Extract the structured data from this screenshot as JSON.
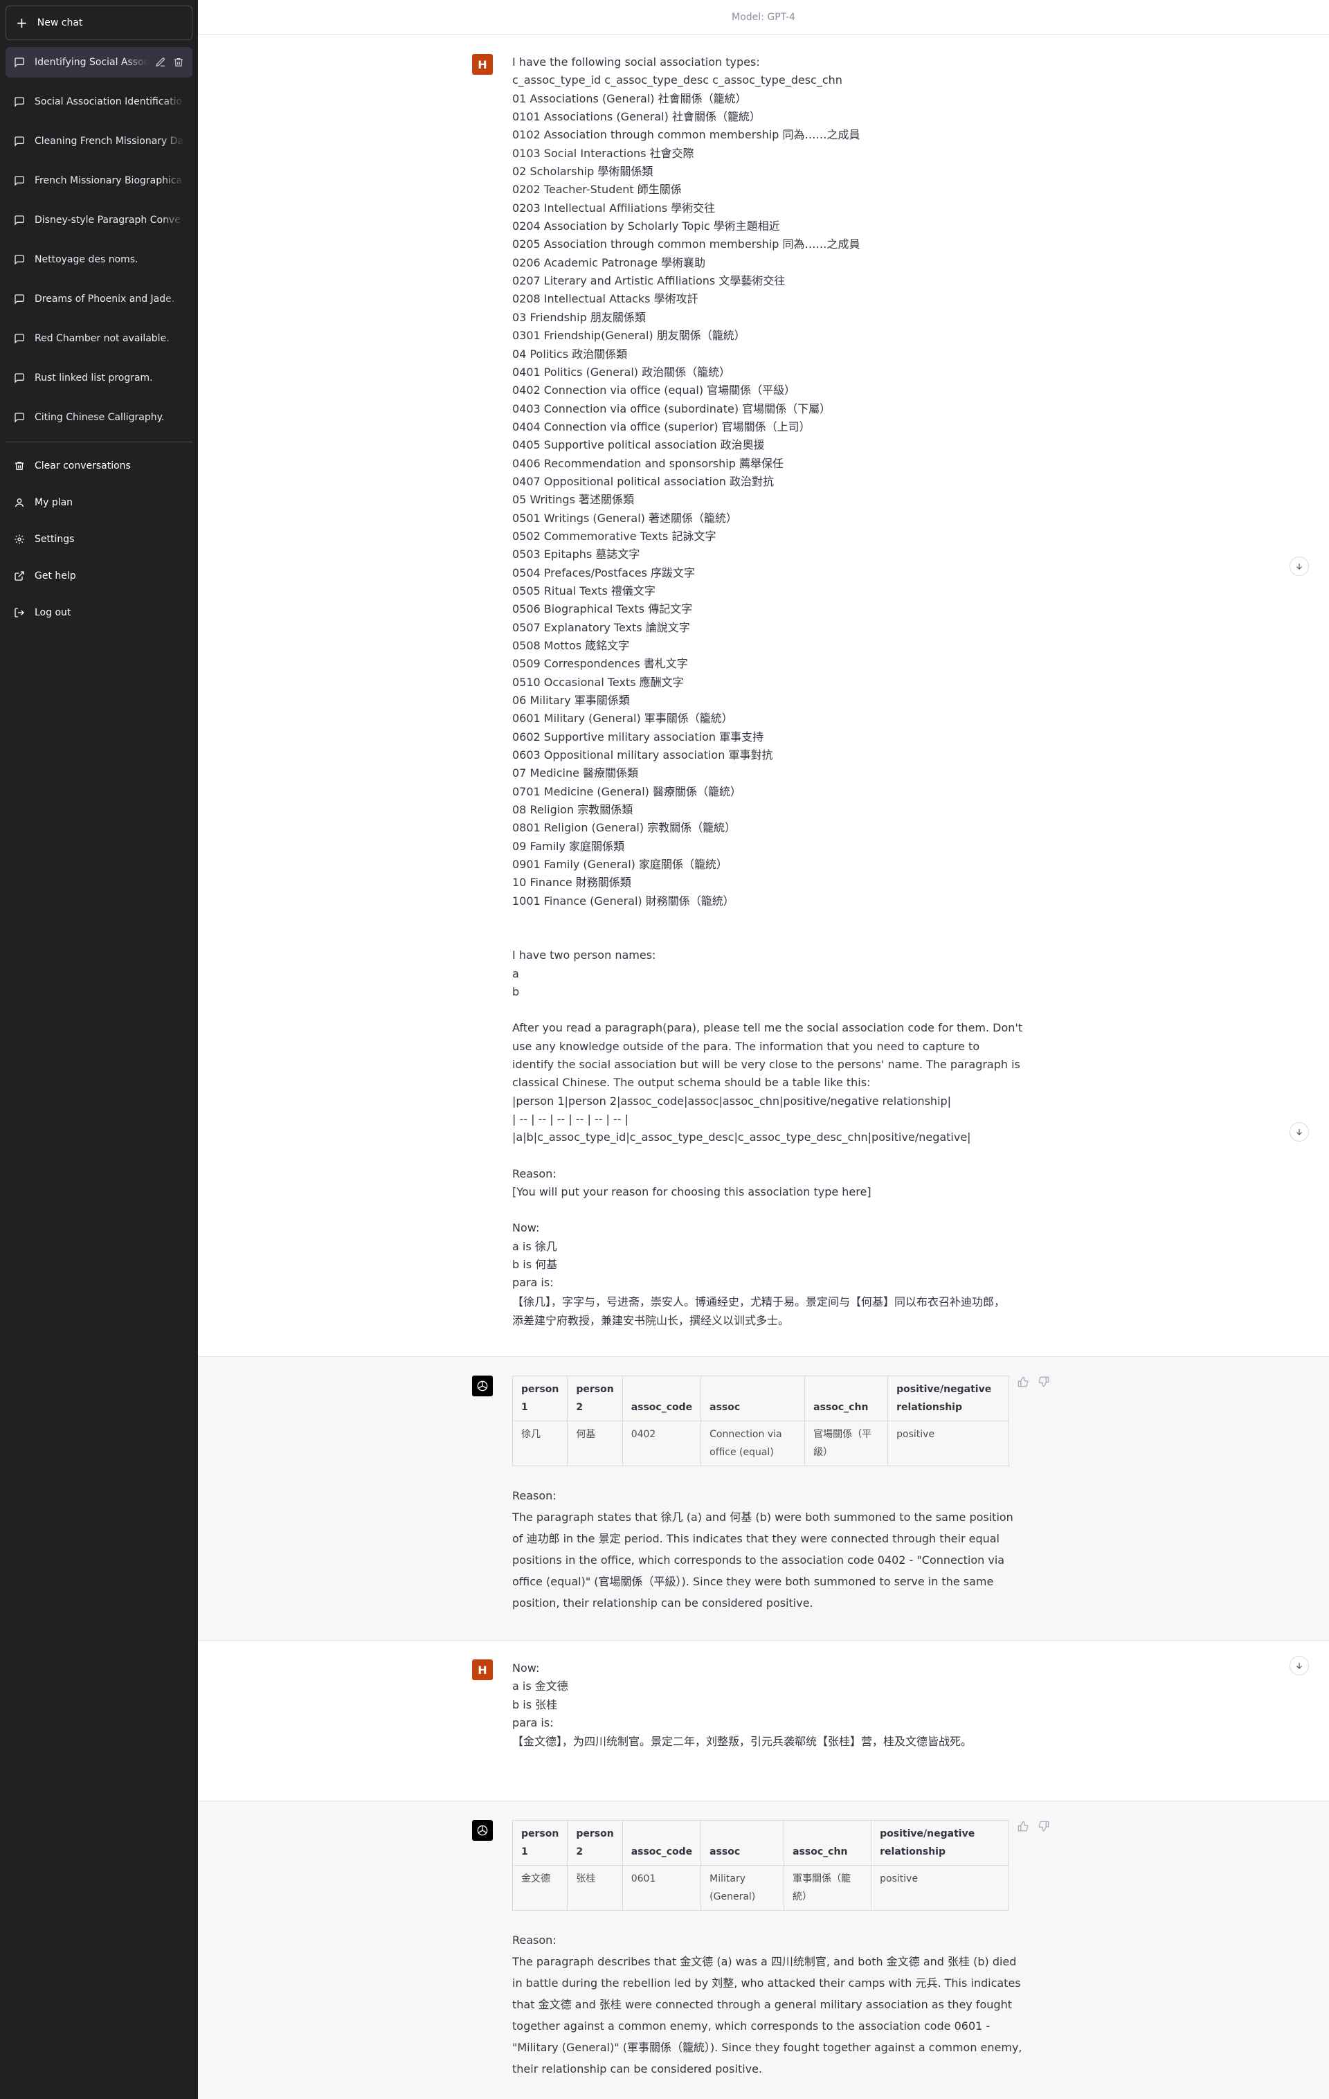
{
  "sidebar": {
    "new_chat": "New chat",
    "conversations": [
      {
        "label": "Identifying Social Assoc",
        "active": true
      },
      {
        "label": "Social Association Identificatio"
      },
      {
        "label": "Cleaning French Missionary Da"
      },
      {
        "label": "French Missionary Biographica"
      },
      {
        "label": "Disney-style Paragraph Conve"
      },
      {
        "label": "Nettoyage des noms."
      },
      {
        "label": "Dreams of Phoenix and Jade."
      },
      {
        "label": "Red Chamber not available."
      },
      {
        "label": "Rust linked list program."
      },
      {
        "label": "Citing Chinese Calligraphy."
      }
    ],
    "menu": {
      "clear": "Clear conversations",
      "plan": "My plan",
      "settings": "Settings",
      "help": "Get help",
      "logout": "Log out"
    }
  },
  "header": {
    "model": "Model: GPT-4"
  },
  "avatars": {
    "user": "H"
  },
  "messages": {
    "m1_lines": [
      "I have the following social association types:",
      "c_assoc_type_id c_assoc_type_desc   c_assoc_type_desc_chn",
      "01   Associations (General)   社會關係（籠統）",
      "0101  Associations (General)   社會關係（籠統）",
      "0102  Association through common membership  同為……之成員",
      "0103 Social Interactions 社會交際",
      "02  Scholarship   學術關係類",
      "0202 Teacher-Student 師生關係",
      "0203 Intellectual Affiliations 學術交往",
      "0204 Association by Scholarly Topic   學術主題相近",
      "0205 Association through common membership  同為……之成員",
      "0206 Academic Patronage   學術襄助",
      "0207 Literary and Artistic Affiliations   文學藝術交往",
      "0208 Intellectual Attacks   學術攻訐",
      "03  Friendship  朋友關係類",
      "0301  Friendship(General)  朋友關係（籠統）",
      "04  Politics 政治關係類",
      "0401  Politics (General)    政治關係（籠統）",
      "0402 Connection via office (equal)    官場關係（平級）",
      "0403 Connection via office (subordinate)  官場關係（下屬）",
      "0404    Connection via office (superior)  官場關係（上司）",
      "0405 Supportive political association  政治奧援",
      "0406    Recommendation and sponsorship  薦舉保任",
      "0407 Oppositional political association  政治對抗",
      "05  Writings  著述關係類",
      "0501  Writings (General)  著述關係（籠統）",
      "0502 Commemorative Texts 記詠文字",
      "0503 Epitaphs 墓誌文字",
      "0504 Prefaces/Postfaces   序跋文字",
      "0505 Ritual Texts    禮儀文字",
      "0506 Biographical Texts 傳記文字",
      "0507 Explanatory Texts  論說文字",
      "0508 Mottos 箴銘文字",
      "0509 Correspondences  書札文字",
      "0510  Occasional Texts 應酬文字",
      "06  Military    軍事關係類",
      "0601  Military (General)   軍事關係（籠統）",
      "0602 Supportive military association   軍事支持",
      "0603 Oppositional military association   軍事對抗",
      "07  Medicine 醫療關係類",
      "0701  Medicine (General)    醫療關係（籠統）",
      "08  Religion   宗教關係類",
      "0801  Religion (General)  宗教關係（籠統）",
      "09  Family  家庭關係類",
      "0901  Family (General)  家庭關係（籠統）",
      "10  Finance   財務關係類",
      "1001  Finance (General)   財務關係（籠統）"
    ],
    "m1_names": [
      "I have two person names:",
      "a",
      "b"
    ],
    "m1_instruction": "After you read a paragraph(para), please tell me the social association code for them. Don't use any knowledge outside of the para. The information that you need to capture to identify the social association but will be very close to the persons' name. The paragraph is classical Chinese. The output schema should be a table like this:",
    "m1_schema": [
      "|person 1|person 2|assoc_code|assoc|assoc_chn|positive/negative relationship|",
      "| -- | -- | -- | -- | -- | -- |",
      "|a|b|c_assoc_type_id|c_assoc_type_desc|c_assoc_type_desc_chn|positive/negative|"
    ],
    "m1_reason": [
      "Reason:",
      "[You will put your reason for choosing this association type here]"
    ],
    "m1_now": [
      "Now:",
      "a is 徐几",
      "b is 何基",
      "para is:"
    ],
    "m1_para": "【徐几】，字字与，号进斋，崇安人。博通经史，尤精于易。景定间与【何基】同以布衣召补迪功郎，添差建宁府教授，兼建安书院山长，撰经义以训式多士。",
    "table_headers": [
      "person 1",
      "person 2",
      "assoc_code",
      "assoc",
      "assoc_chn",
      "positive/negative relationship"
    ],
    "r1_row": [
      "徐几",
      "何基",
      "0402",
      "Connection via office (equal)",
      "官場關係（平級）",
      "positive"
    ],
    "reason_label": "Reason:",
    "r1_reason": "The paragraph states that 徐几 (a) and 何基 (b) were both summoned to the same position of 迪功郎 in the 景定 period. This indicates that they were connected through their equal positions in the office, which corresponds to the association code 0402 - \"Connection via office (equal)\" (官場關係（平級）). Since they were both summoned to serve in the same position, their relationship can be considered positive.",
    "m2_now": [
      "Now:",
      "a is 金文德",
      "b is 张桂",
      "para is:"
    ],
    "m2_para": "【金文德】，为四川统制官。景定二年，刘整叛，引元兵袭郗统【张桂】营，桂及文德皆战死。",
    "r2_row": [
      "金文德",
      "张桂",
      "0601",
      "Military (General)",
      "軍事關係（籠統）",
      "positive"
    ],
    "r2_reason": "The paragraph describes that 金文德 (a) was a 四川统制官, and both 金文德 and 张桂 (b) died in battle during the rebellion led by 刘整, who attacked their camps with 元兵. This indicates that 金文德 and 张桂 were connected through a general military association as they fought together against a common enemy, which corresponds to the association code 0601 - \"Military (General)\" (軍事關係（籠統）). Since they fought together against a common enemy, their relationship can be considered positive."
  },
  "colors": {
    "sidebar_bg": "#202123",
    "user_avatar": "#c2410c",
    "bot_bg": "#f7f7f8"
  }
}
